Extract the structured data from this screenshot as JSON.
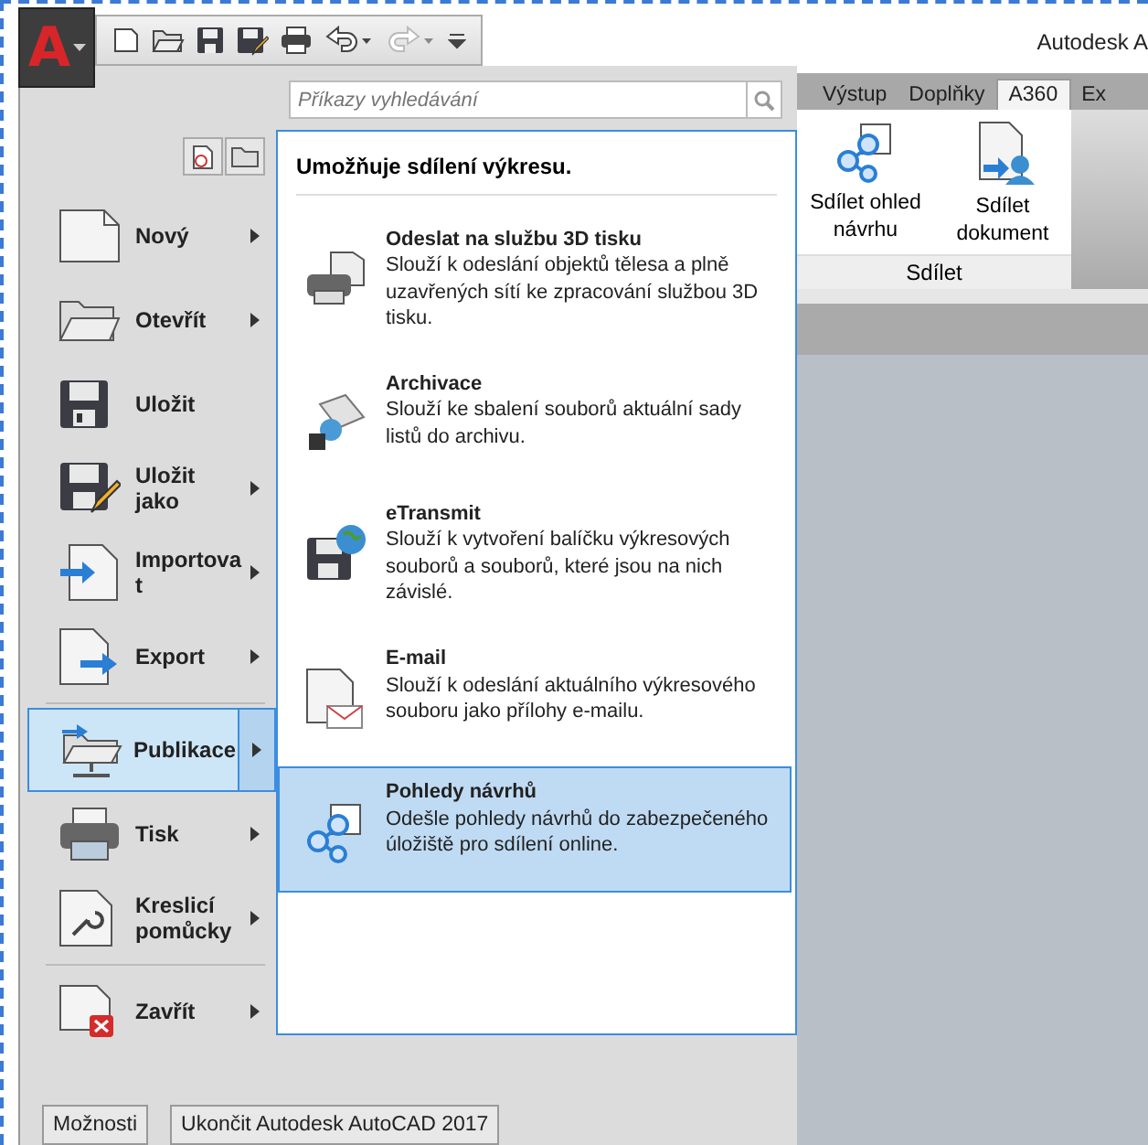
{
  "app_button": {
    "letter": "A"
  },
  "quick_access": [
    {
      "kind": "new"
    },
    {
      "kind": "open"
    },
    {
      "kind": "save"
    },
    {
      "kind": "saveas"
    },
    {
      "kind": "print"
    },
    {
      "kind": "undo"
    },
    {
      "kind": "redo"
    }
  ],
  "window": {
    "title": "Autodesk A"
  },
  "search": {
    "placeholder": "Příkazy vyhledávání"
  },
  "menu_items": [
    {
      "label": "Nový",
      "kind": "new",
      "selected": false,
      "submenu": true,
      "divider_above": false
    },
    {
      "label": "Otevřít",
      "kind": "open",
      "selected": false,
      "submenu": true,
      "divider_above": false
    },
    {
      "label": "Uložit",
      "kind": "save",
      "selected": false,
      "submenu": false,
      "divider_above": false
    },
    {
      "label": "Uložit jako",
      "kind": "saveas",
      "selected": false,
      "submenu": true,
      "divider_above": false
    },
    {
      "label": "Importovat",
      "kind": "import",
      "selected": false,
      "submenu": true,
      "divider_above": false
    },
    {
      "label": "Export",
      "kind": "export",
      "selected": false,
      "submenu": true,
      "divider_above": false
    },
    {
      "label": "Publikace",
      "kind": "publish",
      "selected": true,
      "submenu": true,
      "divider_above": true
    },
    {
      "label": "Tisk",
      "kind": "print",
      "selected": false,
      "submenu": true,
      "divider_above": false
    },
    {
      "label": "Kreslicí pomůcky",
      "kind": "tools",
      "selected": false,
      "submenu": true,
      "divider_above": false
    },
    {
      "label": "Zavřít",
      "kind": "close",
      "selected": false,
      "submenu": true,
      "divider_above": true
    }
  ],
  "submenu": {
    "heading": "Umožňuje sdílení výkresu.",
    "entries": [
      {
        "title": "Odeslat na službu 3D tisku",
        "description": "Slouží k odeslání objektů tělesa a plně uzavřených sítí ke zpracování službou 3D tisku.",
        "kind": "print3d",
        "selected": false
      },
      {
        "title": "Archivace",
        "description": "Slouží ke sbalení souborů aktuální sady listů do archivu.",
        "kind": "archive",
        "selected": false
      },
      {
        "title": "eTransmit",
        "description": "Slouží k vytvoření balíčku výkresových souborů a souborů, které jsou na nich závislé.",
        "kind": "etransmit",
        "selected": false
      },
      {
        "title": "E-mail",
        "description": "Slouží k odeslání aktuálního výkresového souboru jako přílohy e-mailu.",
        "kind": "email",
        "selected": false
      },
      {
        "title": "Pohledy návrhů",
        "description": "Odešle pohledy návrhů do zabezpečeného úložiště pro sdílení online.",
        "kind": "share",
        "selected": true
      }
    ]
  },
  "footer_buttons": [
    "Možnosti",
    "Ukončit Autodesk AutoCAD 2017"
  ],
  "ribbon": {
    "tabs": [
      {
        "label": "Výstup",
        "selected": false
      },
      {
        "label": "Doplňky",
        "selected": false
      },
      {
        "label": "A360",
        "selected": true
      },
      {
        "label": "Ex",
        "selected": false
      }
    ],
    "buttons": [
      {
        "label": "Sdílet ohled návrhu",
        "kind": "share"
      },
      {
        "label": "Sdílet dokument",
        "kind": "document"
      }
    ],
    "panel_label": "Sdílet"
  }
}
